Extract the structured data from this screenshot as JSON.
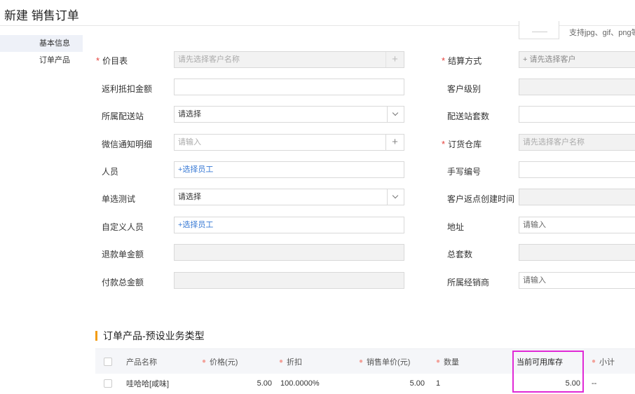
{
  "page": {
    "title": "新建 销售订单"
  },
  "sidebar": {
    "items": [
      {
        "label": "基本信息"
      },
      {
        "label": "订单产品"
      }
    ]
  },
  "upload": {
    "hint": "支持jpg、gif、png等"
  },
  "form": {
    "left": [
      {
        "label": "价目表",
        "required": true,
        "value": "",
        "placeholder": "请先选择客户名称"
      },
      {
        "label": "返利抵扣金额",
        "value": ""
      },
      {
        "label": "所属配送站",
        "value": "请选择"
      },
      {
        "label": "微信通知明细",
        "value": "",
        "placeholder": "请输入"
      },
      {
        "label": "人员",
        "value": "+选择员工"
      },
      {
        "label": "单选测试",
        "value": "请选择"
      },
      {
        "label": "自定义人员",
        "value": "+选择员工"
      },
      {
        "label": "退款单金额",
        "value": ""
      },
      {
        "label": "付款总金额",
        "value": ""
      }
    ],
    "right": [
      {
        "label": "结算方式",
        "required": true,
        "value": "",
        "placeholder": "+ 请先选择客户"
      },
      {
        "label": "客户级别",
        "value": ""
      },
      {
        "label": "配送站套数",
        "value": ""
      },
      {
        "label": "订货仓库",
        "required": true,
        "value": "",
        "placeholder": "请先选择客户名称"
      },
      {
        "label": "手写编号",
        "value": ""
      },
      {
        "label": "客户返点创建时间",
        "value": ""
      },
      {
        "label": "地址",
        "value": "",
        "placeholder": "请输入"
      },
      {
        "label": "总套数",
        "value": ""
      },
      {
        "label": "所属经销商",
        "value": "",
        "placeholder": "请输入"
      }
    ]
  },
  "products": {
    "section_title": "订单产品-预设业务类型",
    "columns": [
      "产品名称",
      "价格(元)",
      "折扣",
      "销售单价(元)",
      "数量",
      "当前可用库存",
      "小计"
    ],
    "rows": [
      {
        "name": "哇哈哈[咸味]",
        "price": "5.00",
        "discount": "100.0000%",
        "unit_price": "5.00",
        "qty": "1",
        "stock": "5.00",
        "subtotal": "--"
      }
    ]
  },
  "colors": {
    "required": "#e5413c",
    "accent": "#f39c12",
    "link": "#3a7bd5",
    "highlight": "#e02ad6"
  }
}
